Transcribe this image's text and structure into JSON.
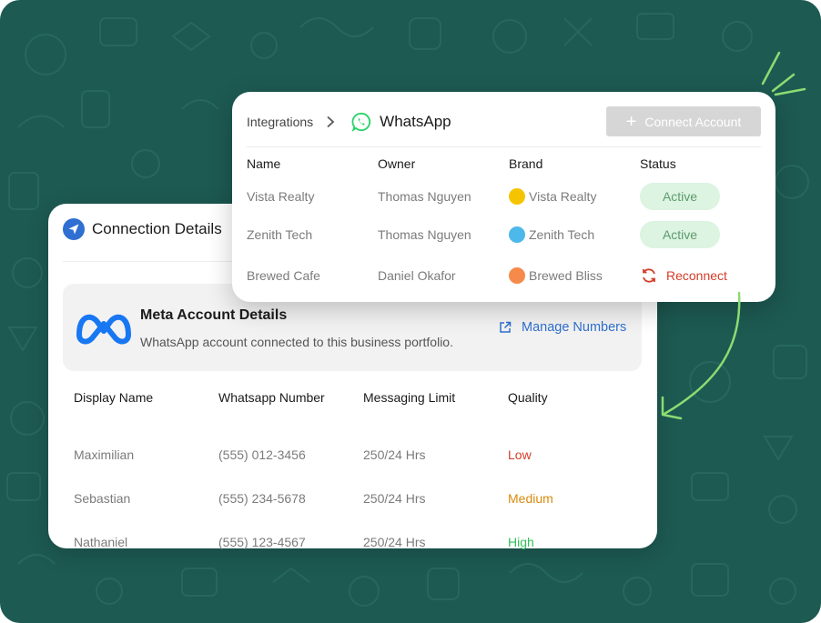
{
  "colors": {
    "background": "#1d5a52",
    "accent_blue": "#2f6fd1",
    "whatsapp_green": "#25d366",
    "active_bg": "#dcf4e1",
    "active_text": "#5f9a6d",
    "reconnect_red": "#d43c2a",
    "quality_low": "#d43c2a",
    "quality_medium": "#d98a0b",
    "quality_high": "#2fbf5c",
    "arrow_green": "#8bdc72"
  },
  "connection_details": {
    "icon": "send-icon",
    "title": "Connection Details",
    "meta": {
      "logo": "meta-logo",
      "title": "Meta Account Details",
      "subtitle": "WhatsApp account connected to this business portfolio.",
      "manage_icon": "external-link-icon",
      "manage_label": "Manage Numbers"
    },
    "table": {
      "headers": [
        "Display Name",
        "Whatsapp Number",
        "Messaging Limit",
        "Quality"
      ],
      "rows": [
        {
          "name": "Maximilian",
          "number": "(555) 012-3456",
          "limit": "250/24 Hrs",
          "quality": "Low",
          "quality_color": "#d43c2a"
        },
        {
          "name": "Sebastian",
          "number": "(555) 234-5678",
          "limit": "250/24 Hrs",
          "quality": "Medium",
          "quality_color": "#d98a0b"
        },
        {
          "name": "Nathaniel",
          "number": "(555) 123-4567",
          "limit": "250/24 Hrs",
          "quality": "High",
          "quality_color": "#2fbf5c"
        }
      ]
    }
  },
  "integrations": {
    "breadcrumb": {
      "root": "Integrations",
      "separator_icon": "chevron-right-icon",
      "current_icon": "whatsapp-icon",
      "current": "WhatsApp"
    },
    "connect_button": {
      "icon": "plus-icon",
      "label": "Connect Account"
    },
    "table": {
      "headers": [
        "Name",
        "Owner",
        "Brand",
        "Status"
      ],
      "rows": [
        {
          "name": "Vista Realty",
          "owner": "Thomas Nguyen",
          "brand": "Vista Realty",
          "brand_color": "#f5c400",
          "status": "Active",
          "status_type": "active"
        },
        {
          "name": "Zenith Tech",
          "owner": "Thomas Nguyen",
          "brand": "Zenith Tech",
          "brand_color": "#4db8ea",
          "status": "Active",
          "status_type": "active"
        },
        {
          "name": "Brewed Cafe",
          "owner": "Daniel Okafor",
          "brand": "Brewed Bliss",
          "brand_color": "#f58a4b",
          "status": "Reconnect",
          "status_type": "reconnect"
        }
      ]
    }
  }
}
